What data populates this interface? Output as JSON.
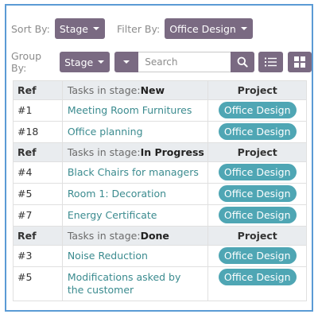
{
  "toolbar": {
    "sort_label": "Sort By:",
    "sort_value": "Stage",
    "filter_label": "Filter By:",
    "filter_value": "Office Design",
    "group_label": "Group By:",
    "group_value": "Stage",
    "search_placeholder": "Search"
  },
  "groups": [
    {
      "ref_header": "Ref",
      "stage_prefix": "Tasks in stage:",
      "stage_name": "New",
      "project_header": "Project",
      "rows": [
        {
          "ref": "#1",
          "task": "Meeting Room Furnitures",
          "project": "Office Design"
        },
        {
          "ref": "#18",
          "task": "Office planning",
          "project": "Office Design"
        }
      ]
    },
    {
      "ref_header": "Ref",
      "stage_prefix": "Tasks in stage:",
      "stage_name": "In Progress",
      "project_header": "Project",
      "rows": [
        {
          "ref": "#4",
          "task": "Black Chairs for managers",
          "project": "Office Design"
        },
        {
          "ref": "#5",
          "task": "Room 1: Decoration",
          "project": "Office Design"
        },
        {
          "ref": "#7",
          "task": "Energy Certificate",
          "project": "Office Design"
        }
      ]
    },
    {
      "ref_header": "Ref",
      "stage_prefix": "Tasks in stage:",
      "stage_name": "Done",
      "project_header": "Project",
      "rows": [
        {
          "ref": "#3",
          "task": "Noise Reduction",
          "project": "Office Design"
        },
        {
          "ref": "#5",
          "task": "Modifications asked by the customer",
          "project": "Office Design"
        }
      ]
    }
  ],
  "colors": {
    "button": "#7a6a82",
    "badge": "#4fa6b4",
    "task_link": "#3b8b8f",
    "frame": "#5b9bd5"
  },
  "icons": {
    "search": "magnifier-icon",
    "list_view": "list-view-icon",
    "grid_view": "grid-view-icon"
  }
}
